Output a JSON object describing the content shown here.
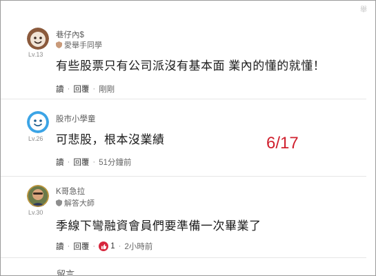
{
  "header": {
    "report_label": "舉"
  },
  "comments": [
    {
      "username": "巷仔內$",
      "level": "Lv.13",
      "badge": "愛舉手同學",
      "text": "有些股票只有公司派沒有基本面 業內的懂的就懂！",
      "reply_label": "讀",
      "respond_label": "回覆",
      "time": "剛剛",
      "avatar_icon": "brown-face-icon"
    },
    {
      "username": "股市小學童",
      "level": "Lv.26",
      "badge": "",
      "text": "可悲股，根本沒業績",
      "reply_label": "讀",
      "respond_label": "回覆",
      "time": "51分鐘前",
      "avatar_icon": "blue-face-icon"
    },
    {
      "username": "K哥急拉",
      "level": "Lv.30",
      "badge": "解答大師",
      "text": "季線下彎融資會員們要準備一次畢業了",
      "reply_label": "讀",
      "respond_label": "回覆",
      "like_count": "1",
      "time": "2小時前",
      "avatar_icon": "user-photo-icon"
    }
  ],
  "annotation": "6/17",
  "footer": {
    "label": "留言"
  },
  "colors": {
    "annotation": "#d0202e",
    "like": "#d7263d"
  }
}
